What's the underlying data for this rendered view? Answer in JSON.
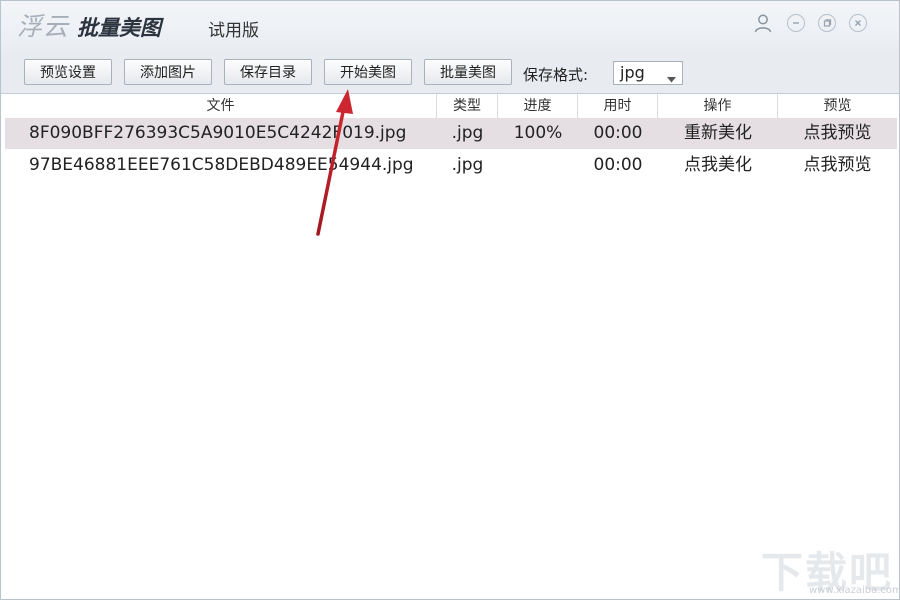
{
  "window": {
    "logo_text": "浮云",
    "app_name": "批量美图",
    "edition": "试用版"
  },
  "title_icons": [
    "user-icon",
    "minimize-icon",
    "maximize-icon",
    "close-icon"
  ],
  "toolbar": {
    "preview_settings": "预览设置",
    "add_images": "添加图片",
    "save_dir": "保存目录",
    "start_beautify": "开始美图",
    "batch_beautify": "批量美图",
    "save_format_label": "保存格式:",
    "save_format_value": "jpg"
  },
  "table": {
    "columns": {
      "file": "文件",
      "type": "类型",
      "progress": "进度",
      "time": "用时",
      "action": "操作",
      "preview": "预览"
    },
    "rows": [
      {
        "file": "8F090BFF276393C5A9010E5C4242F019.jpg",
        "type": ".jpg",
        "progress": "100%",
        "time": "00:00",
        "action": "重新美化",
        "preview": "点我预览"
      },
      {
        "file": "97BE46881EEE761C58DEBD489EE54944.jpg",
        "type": ".jpg",
        "progress": "",
        "time": "00:00",
        "action": "点我美化",
        "preview": "点我预览"
      }
    ]
  },
  "watermark": {
    "text": "下载吧",
    "sub": "www.xiazaiba.com"
  },
  "colors": {
    "annotation_arrow": "#c8242b",
    "selected_row": "#e5dfe3"
  }
}
